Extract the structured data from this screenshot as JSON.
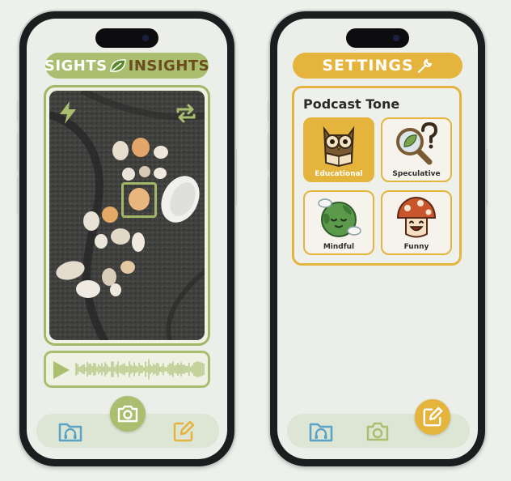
{
  "left_screen": {
    "brand_word1": "SIGHTS",
    "brand_word2": "INSIGHTS",
    "camera_icon": "flash-icon",
    "switch_icon": "switch-camera-icon",
    "audio_icon": "play-icon",
    "nav": {
      "left_icon": "podcast-folder-icon",
      "center_icon": "camera-icon",
      "right_icon": "edit-icon"
    }
  },
  "right_screen": {
    "header": "SETTINGS",
    "header_icon": "wrench-icon",
    "panel_title": "Podcast Tone",
    "tones": [
      {
        "label": "Educational",
        "icon": "owl-reading-icon",
        "selected": true
      },
      {
        "label": "Speculative",
        "icon": "magnifier-question-icon",
        "selected": false
      },
      {
        "label": "Mindful",
        "icon": "calm-earth-icon",
        "selected": false
      },
      {
        "label": "Funny",
        "icon": "laughing-mushroom-icon",
        "selected": false
      }
    ],
    "nav": {
      "left_icon": "podcast-folder-icon",
      "center_icon": "camera-icon",
      "right_icon": "edit-icon"
    }
  },
  "colors": {
    "green_accent": "#a9be6e",
    "gold_accent": "#e4b43c",
    "brown_text": "#6b4c1e",
    "nav_blue": "#5aa3c7"
  }
}
